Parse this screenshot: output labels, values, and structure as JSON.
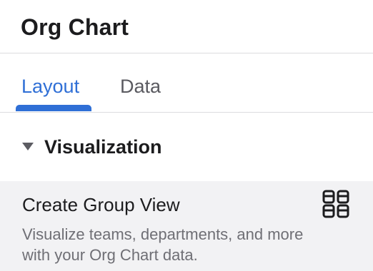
{
  "header": {
    "title": "Org Chart"
  },
  "tabs": [
    {
      "label": "Layout",
      "active": true
    },
    {
      "label": "Data",
      "active": false
    }
  ],
  "section": {
    "title": "Visualization",
    "expanded": true
  },
  "items": [
    {
      "title": "Create Group View",
      "description": "Visualize teams, departments, and more with your Org Chart data.",
      "icon": "grid-layout-icon"
    }
  ],
  "colors": {
    "accent": "#2f6fd6",
    "item_background": "#f2f2f4",
    "divider": "#dcdcdf"
  }
}
